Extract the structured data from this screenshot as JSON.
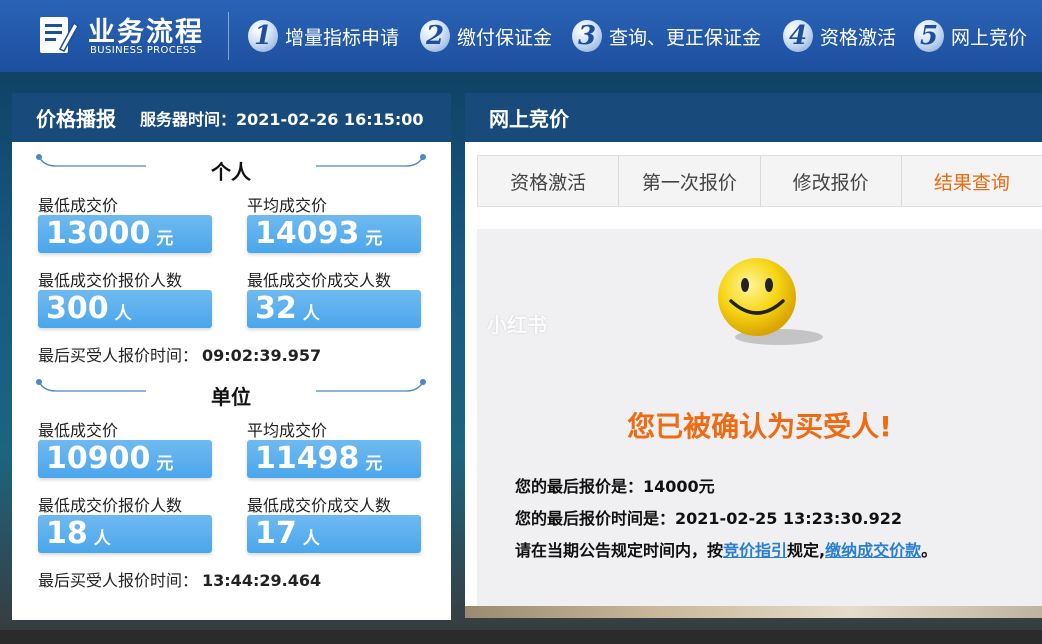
{
  "header": {
    "logo_title": "业务流程",
    "logo_subtitle": "BUSINESS PROCESS",
    "steps": [
      {
        "num": "1",
        "label": "增量指标申请"
      },
      {
        "num": "2",
        "label": "缴付保证金"
      },
      {
        "num": "3",
        "label": "查询、更正保证金"
      },
      {
        "num": "4",
        "label": "资格激活"
      },
      {
        "num": "5",
        "label": "网上竞价"
      }
    ]
  },
  "price_panel": {
    "title": "价格播报",
    "server_time_label": "服务器时间：",
    "server_time": "2021-02-26 16:15:00",
    "individual": {
      "title": "个人",
      "min_price_label": "最低成交价",
      "min_price": "13000",
      "min_price_unit": "元",
      "avg_price_label": "平均成交价",
      "avg_price": "14093",
      "avg_price_unit": "元",
      "min_bidders_label": "最低成交价报价人数",
      "min_bidders": "300",
      "min_bidders_unit": "人",
      "min_deals_label": "最低成交价成交人数",
      "min_deals": "32",
      "min_deals_unit": "人",
      "last_bid_label": "最后买受人报价时间：",
      "last_bid_time": "09:02:39.957"
    },
    "unit": {
      "title": "单位",
      "min_price_label": "最低成交价",
      "min_price": "10900",
      "min_price_unit": "元",
      "avg_price_label": "平均成交价",
      "avg_price": "11498",
      "avg_price_unit": "元",
      "min_bidders_label": "最低成交价报价人数",
      "min_bidders": "18",
      "min_bidders_unit": "人",
      "min_deals_label": "最低成交价成交人数",
      "min_deals": "17",
      "min_deals_unit": "人",
      "last_bid_label": "最后买受人报价时间：",
      "last_bid_time": "13:44:29.464"
    }
  },
  "auction_panel": {
    "title": "网上竞价",
    "tabs": [
      {
        "label": "资格激活"
      },
      {
        "label": "第一次报价"
      },
      {
        "label": "修改报价"
      },
      {
        "label": "结果查询"
      }
    ],
    "watermark": "小红书",
    "confirm_message": "您已被确认为买受人!",
    "last_price_label": "您的最后报价是：",
    "last_price": "14000元",
    "last_time_label": "您的最后报价时间是：",
    "last_time": "2021-02-25 13:23:30.922",
    "notice_prefix": "请在当期公告规定时间内，按",
    "notice_link1": "竞价指引",
    "notice_middle": "规定,",
    "notice_link2": "缴纳成交价款",
    "notice_suffix": "。"
  },
  "colors": {
    "header_blue": "#1d4f9f",
    "panel_header": "#184a7c",
    "value_box": "#4aa6ec",
    "accent_orange": "#f06a12",
    "link_blue": "#2a7fd0"
  }
}
